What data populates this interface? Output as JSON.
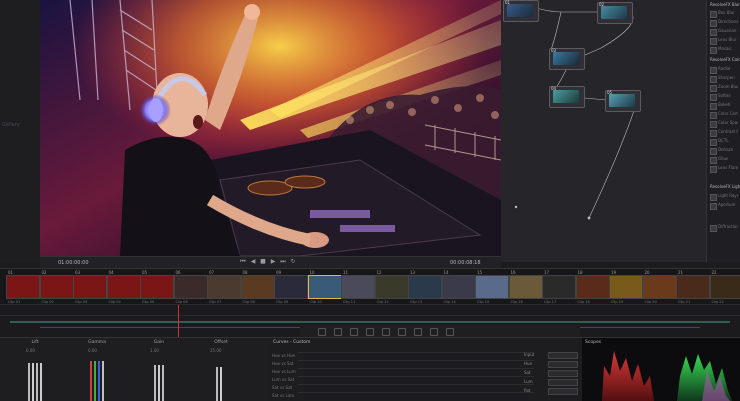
{
  "viewer": {
    "timecode_left": "01:00:00:00",
    "timecode_right": "00:00:08:18",
    "scene_description": "DJ wearing glowing headphones at a festival mixing desk"
  },
  "left_gutter": {
    "hint": "Gallery"
  },
  "node_graph": {
    "nodes": [
      {
        "num": "01",
        "label": ""
      },
      {
        "num": "02",
        "label": ""
      },
      {
        "num": "03",
        "label": ""
      },
      {
        "num": "04",
        "label": ""
      },
      {
        "num": "05",
        "label": ""
      }
    ]
  },
  "library": {
    "section_1": "ResolveFX Blur",
    "section_2": "ResolveFX Color",
    "section_3": "ResolveFX Light",
    "items": [
      "Box Blur",
      "Directional",
      "Gaussian",
      "Lens Blur",
      "Mosaic",
      "Radial",
      "Sharpen",
      "Zoom Blur",
      "Soften",
      "Bokeh",
      "Color Comp",
      "Color Space",
      "Contrast Pop",
      "DCTL",
      "Dehaze",
      "Glow",
      "Lens Flare",
      "Light Rays",
      "Aperture",
      "Diffraction"
    ]
  },
  "clips": [
    {
      "n": "01",
      "c": "Clip 01"
    },
    {
      "n": "02",
      "c": "Clip 02"
    },
    {
      "n": "03",
      "c": "Clip 03"
    },
    {
      "n": "04",
      "c": "Clip 04"
    },
    {
      "n": "05",
      "c": "Clip 05"
    },
    {
      "n": "06",
      "c": "Clip 06"
    },
    {
      "n": "07",
      "c": "Clip 07"
    },
    {
      "n": "08",
      "c": "Clip 08"
    },
    {
      "n": "09",
      "c": "Clip 09"
    },
    {
      "n": "10",
      "c": "Clip 10"
    },
    {
      "n": "11",
      "c": "Clip 11"
    },
    {
      "n": "12",
      "c": "Clip 12"
    },
    {
      "n": "13",
      "c": "Clip 13"
    },
    {
      "n": "14",
      "c": "Clip 14"
    },
    {
      "n": "15",
      "c": "Clip 15"
    },
    {
      "n": "16",
      "c": "Clip 16"
    },
    {
      "n": "17",
      "c": "Clip 17"
    },
    {
      "n": "18",
      "c": "Clip 18"
    },
    {
      "n": "19",
      "c": "Clip 19"
    },
    {
      "n": "20",
      "c": "Clip 20"
    },
    {
      "n": "21",
      "c": "Clip 21"
    },
    {
      "n": "22",
      "c": "Clip 22"
    }
  ],
  "color_wheels": {
    "lift": {
      "title": "Lift",
      "v": "0.00"
    },
    "gamma": {
      "title": "Gamma",
      "v": "0.00"
    },
    "gain": {
      "title": "Gain",
      "v": "1.00"
    },
    "offset": {
      "title": "Offset",
      "v": "25.00"
    }
  },
  "curves": {
    "header": "Curves - Custom",
    "rows": [
      "Hue vs Hue",
      "Hue vs Sat",
      "Hue vs Lum",
      "Lum vs Sat",
      "Sat vs Sat",
      "Sat vs Lum"
    ],
    "side": [
      {
        "l": "Input"
      },
      {
        "l": "Hue"
      },
      {
        "l": "Sat"
      },
      {
        "l": "Lum"
      },
      {
        "l": "Rot"
      }
    ]
  },
  "scopes": {
    "header": "Scopes"
  }
}
